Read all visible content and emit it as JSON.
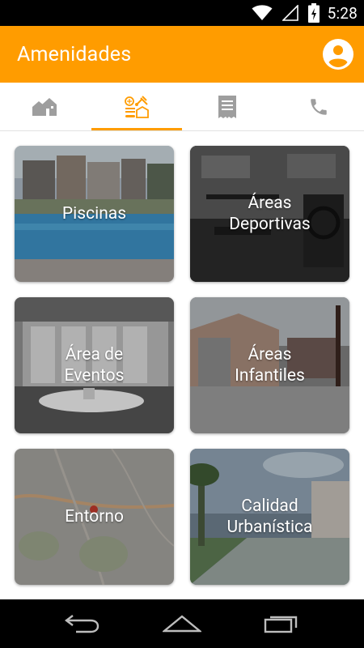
{
  "status_bar": {
    "time": "5:28",
    "icons": [
      "wifi-icon",
      "signal-icon",
      "battery-charging-icon"
    ]
  },
  "app_bar": {
    "title": "Amenidades",
    "profile_icon": "account-circle-icon"
  },
  "tabs": [
    {
      "name": "home",
      "icon": "houses-icon",
      "active": false
    },
    {
      "name": "amenities",
      "icon": "amenities-icon",
      "active": true
    },
    {
      "name": "documents",
      "icon": "receipt-icon",
      "active": false
    },
    {
      "name": "contact",
      "icon": "phone-icon",
      "active": false
    }
  ],
  "colors": {
    "accent": "#ff9c00",
    "tab_inactive": "#9e9e9e"
  },
  "cards": [
    {
      "label": "Piscinas",
      "image": "pool-photo"
    },
    {
      "label": "Áreas\nDeportivas",
      "image": "gym-photo"
    },
    {
      "label": "Área de\nEventos",
      "image": "event-hall-photo"
    },
    {
      "label": "Áreas\nInfantiles",
      "image": "playground-photo"
    },
    {
      "label": "Entorno",
      "image": "map-photo"
    },
    {
      "label": "Calidad\nUrbanística",
      "image": "street-photo"
    }
  ],
  "nav_bar": {
    "buttons": [
      "back-icon",
      "home-icon",
      "recents-icon"
    ]
  }
}
